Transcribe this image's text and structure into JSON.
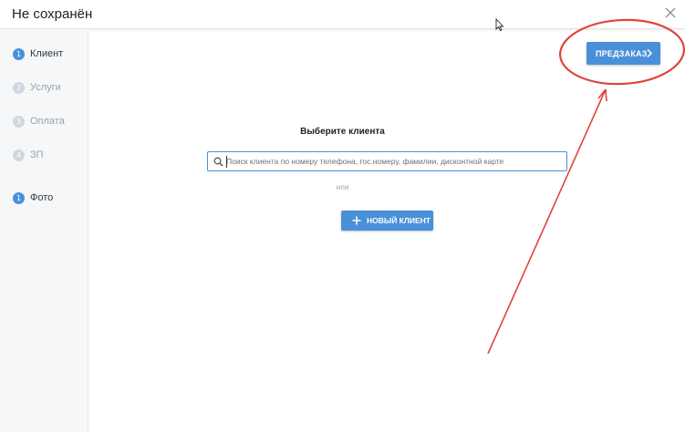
{
  "window": {
    "title": "Не сохранён",
    "close_icon": "close-icon"
  },
  "sidebar": {
    "items": [
      {
        "num": "1",
        "label": "Клиент",
        "state": "active"
      },
      {
        "num": "2",
        "label": "Услуги",
        "state": "inactive"
      },
      {
        "num": "3",
        "label": "Оплата",
        "state": "inactive"
      },
      {
        "num": "4",
        "label": "ЗП",
        "state": "inactive"
      },
      {
        "num": "1",
        "label": "Фото",
        "state": "active"
      }
    ]
  },
  "toolbar": {
    "preorder_label": "ПРЕДЗАКАЗ",
    "preorder_icon": "chevron-right-icon"
  },
  "main": {
    "heading": "Выберите клиента",
    "search": {
      "value": "",
      "placeholder": "Поиск клиента по номеру телефона, гос.номеру, фамилии, дисконтной карте",
      "icon": "search-icon"
    },
    "or_label": "или",
    "new_client_label": "НОВЫЙ КЛИЕНТ",
    "new_client_icon": "plus-icon"
  },
  "colors": {
    "accent": "#4a90d9",
    "sidebar_bg": "#f6f7f8",
    "step_inactive": "#cfd8e0",
    "annotation_red": "#e0443a"
  }
}
